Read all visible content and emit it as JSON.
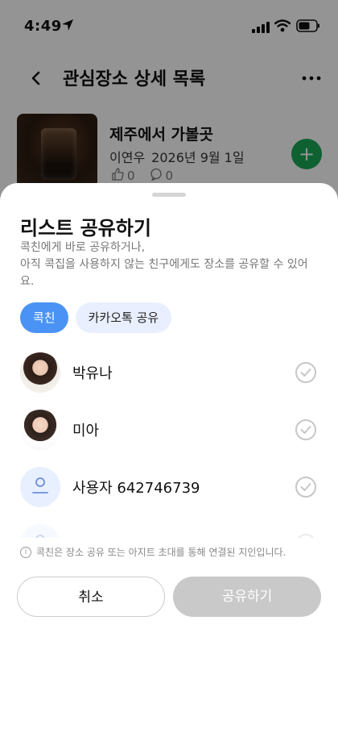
{
  "status_bar": {
    "time": "4:49"
  },
  "nav": {
    "title": "관심장소 상세 목록"
  },
  "card": {
    "title": "제주에서 가볼곳",
    "author": "이연우",
    "date": "2026년 9월 1일",
    "likes": "0",
    "comments": "0"
  },
  "sheet": {
    "title": "리스트 공유하기",
    "description": "콕친에게 바로 공유하거나,\n아직 콕집을 사용하지 않는 친구에게도 장소를 공유할 수 있어요.",
    "tabs": [
      {
        "label": "콕친",
        "active": true
      },
      {
        "label": "카카오톡 공유",
        "active": false
      }
    ],
    "friends": [
      {
        "name": "박유나",
        "avatar": "photo"
      },
      {
        "name": "미아",
        "avatar": "photo"
      },
      {
        "name": "사용자 642746739",
        "avatar": "default-user-icon"
      },
      {
        "name": "",
        "avatar": "default-user-icon"
      }
    ],
    "info_note": "콕친은 장소 공유 또는 아지트 초대를 통해 연결된 지인입니다.",
    "cancel_label": "취소",
    "share_label": "공유하기"
  },
  "colors": {
    "accent": "#4a93f5",
    "tab_inactive_bg": "#e9efff",
    "fab_green": "#1aa757",
    "disabled_button": "#c9c9c9"
  }
}
